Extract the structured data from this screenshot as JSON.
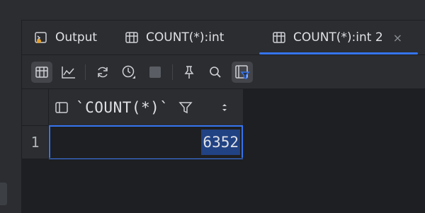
{
  "tabs": [
    {
      "label": "Output",
      "icon": "output-console-icon",
      "active": false
    },
    {
      "label": "COUNT(*):int",
      "icon": "table-icon",
      "active": false
    },
    {
      "label": "COUNT(*):int 2",
      "icon": "table-icon",
      "active": true,
      "close": "×"
    }
  ],
  "toolbar": {
    "buttons": [
      "table-view-icon",
      "chart-view-icon",
      "refresh-icon",
      "history-clock-icon",
      "stop-icon",
      "pin-icon",
      "search-icon",
      "filter-panel-icon"
    ]
  },
  "grid": {
    "column_header": "`COUNT(*)`",
    "rows": [
      {
        "number": "1",
        "value": "6352"
      }
    ]
  },
  "colors": {
    "accent": "#3574f0",
    "selection": "#214283",
    "panel": "#2b2d30",
    "background": "#1e1f22"
  }
}
